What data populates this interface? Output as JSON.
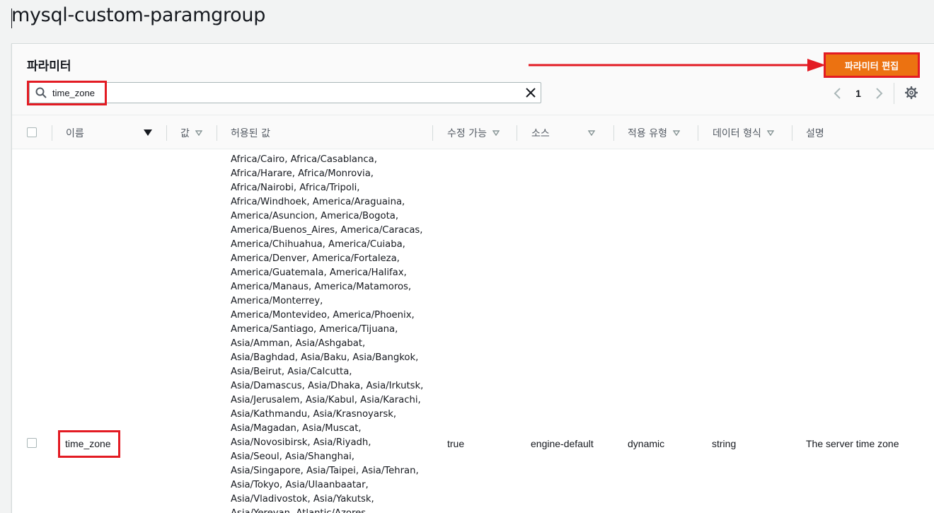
{
  "page": {
    "title": "mysql-custom-paramgroup"
  },
  "panel": {
    "title": "파라미터",
    "edit_button": "파라미터 편집",
    "accent_color": "#ec7211",
    "annotation_color": "#e31b23"
  },
  "search": {
    "value": "time_zone",
    "icon": "search-icon",
    "clear_icon": "close-icon"
  },
  "pagination": {
    "current_page": "1"
  },
  "table": {
    "columns": [
      {
        "label": "이름"
      },
      {
        "label": "값"
      },
      {
        "label": "허용된 값"
      },
      {
        "label": "수정 가능"
      },
      {
        "label": "소스"
      },
      {
        "label": "적용 유형"
      },
      {
        "label": "데이터 형식"
      },
      {
        "label": "설명"
      }
    ],
    "rows": [
      {
        "name": "time_zone",
        "value": "",
        "modifiable": "true",
        "source": "engine-default",
        "apply_type": "dynamic",
        "data_type": "string",
        "description": "The server time zone",
        "allowed_values_lines": [
          "Africa/Cairo, Africa/Casablanca,",
          "Africa/Harare, Africa/Monrovia,",
          "Africa/Nairobi, Africa/Tripoli,",
          "Africa/Windhoek, America/Araguaina,",
          "America/Asuncion, America/Bogota,",
          "America/Buenos_Aires, America/Caracas,",
          "America/Chihuahua, America/Cuiaba,",
          "America/Denver, America/Fortaleza,",
          "America/Guatemala, America/Halifax,",
          "America/Manaus, America/Matamoros,",
          "America/Monterrey,",
          "America/Montevideo, America/Phoenix,",
          "America/Santiago, America/Tijuana,",
          "Asia/Amman, Asia/Ashgabat,",
          "Asia/Baghdad, Asia/Baku, Asia/Bangkok,",
          "Asia/Beirut, Asia/Calcutta,",
          "Asia/Damascus, Asia/Dhaka, Asia/Irkutsk,",
          "Asia/Jerusalem, Asia/Kabul, Asia/Karachi,",
          "Asia/Kathmandu, Asia/Krasnoyarsk,",
          "Asia/Magadan, Asia/Muscat,",
          "Asia/Novosibirsk, Asia/Riyadh,",
          "Asia/Seoul, Asia/Shanghai,",
          "Asia/Singapore, Asia/Taipei, Asia/Tehran,",
          "Asia/Tokyo, Asia/Ulaanbaatar,",
          "Asia/Vladivostok, Asia/Yakutsk,",
          "Asia/Yerevan, Atlantic/Azores,"
        ]
      }
    ]
  }
}
